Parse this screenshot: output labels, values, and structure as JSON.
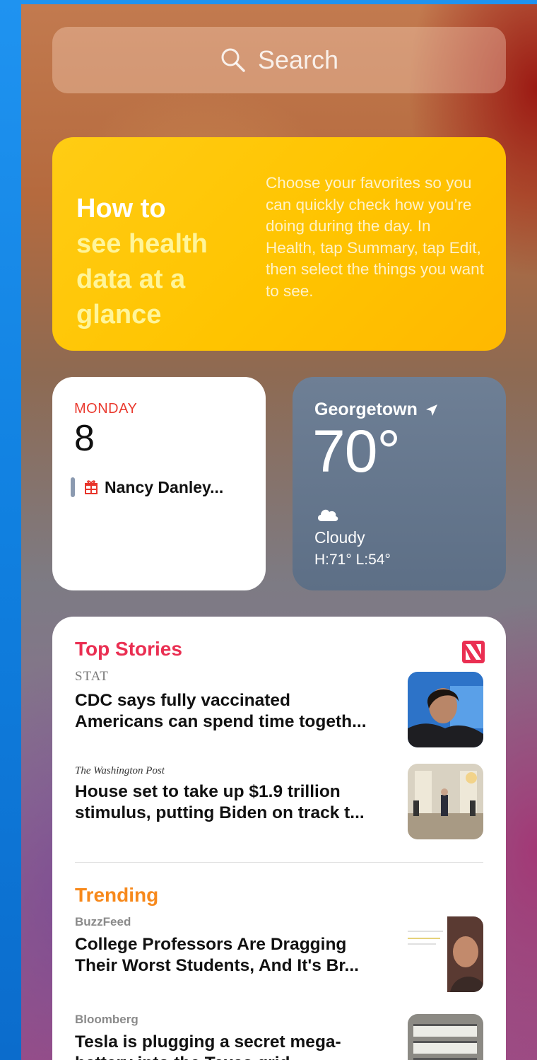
{
  "search": {
    "placeholder": "Search",
    "icon": "search-icon"
  },
  "health_tip": {
    "title_line1": "How to",
    "title_rest": "see health data at a glance",
    "body": "Choose your favorites so you can quickly check how you’re doing during the day. In Health, tap Summary, tap Edit, then select the things you want to see."
  },
  "calendar": {
    "day": "MONDAY",
    "date": "8",
    "event": "Nancy Danley...",
    "event_icon": "gift-icon"
  },
  "weather": {
    "city": "Georgetown",
    "location_icon": "location-arrow-icon",
    "temp": "70°",
    "condition_icon": "cloud-icon",
    "condition": "Cloudy",
    "high_low": "H:71° L:54°"
  },
  "news": {
    "logo": "apple-news-icon",
    "top_stories": {
      "title": "Top Stories",
      "items": [
        {
          "publisher": "STAT",
          "line1": "CDC says fully vaccinated",
          "line2": "Americans can spend time togeth..."
        },
        {
          "publisher": "The Washington Post",
          "line1": "House set to take up $1.9 trillion",
          "line2": "stimulus, putting Biden on track t..."
        }
      ]
    },
    "trending": {
      "title": "Trending",
      "items": [
        {
          "publisher": "BuzzFeed",
          "line1": "College Professors Are Dragging",
          "line2": "Their Worst Students, And It's Br..."
        },
        {
          "publisher": "Bloomberg",
          "line1": "Tesla is plugging a secret mega-",
          "line2": "battery into the Texas grid"
        }
      ]
    }
  },
  "colors": {
    "health_yellow": "#ffc400",
    "calendar_red": "#ea3b30",
    "weather_slate": "#6e7f95",
    "top_stories_pink": "#ea2f52",
    "trending_orange": "#f7891c"
  }
}
